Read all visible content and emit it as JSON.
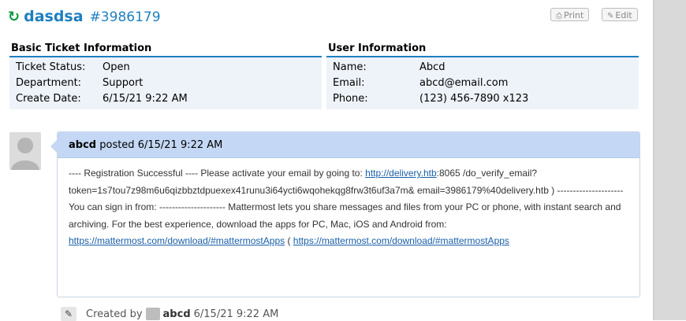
{
  "header": {
    "subject": "dasdsa",
    "number": "#3986179",
    "print_label": "Print",
    "edit_label": "Edit"
  },
  "ticket_info": {
    "title": "Basic Ticket Information",
    "rows": [
      {
        "label": "Ticket Status:",
        "value": "Open"
      },
      {
        "label": "Department:",
        "value": "Support"
      },
      {
        "label": "Create Date:",
        "value": "6/15/21 9:22 AM"
      }
    ]
  },
  "user_info": {
    "title": "User Information",
    "rows": [
      {
        "label": "Name:",
        "value": "Abcd"
      },
      {
        "label": "Email:",
        "value": "abcd@email.com"
      },
      {
        "label": "Phone:",
        "value": "(123) 456-7890 x123"
      }
    ]
  },
  "post": {
    "author": "abcd",
    "posted_text": "posted 6/15/21 9:22 AM",
    "body_1": "---- Registration Successful ---- Please activate your email by going to: ",
    "link_1": "http://delivery.htb",
    "body_2": ":8065 /do_verify_email?token=1s7tou7z98m6u6qizbbztdpuexex41runu3i64ycti6wqohekqg8frw3t6uf3a7m& email=3986179%40delivery.htb ) --------------------- You can sign in from: --------------------- Mattermost lets you share messages and files from your PC or phone, with instant search and archiving. For the best experience, download the apps for PC, Mac, iOS and Android from: ",
    "link_2": "https://mattermost.com/download/#mattermostApps",
    "body_3": " ( ",
    "link_3": "https://mattermost.com/download/#mattermostApps",
    "body_4": ""
  },
  "footer": {
    "created_by": "Created by",
    "author": "abcd",
    "time": "6/15/21 9:22 AM"
  },
  "colors": {
    "accent": "#1d7fc1",
    "refresh_icon": "#0a9a3d",
    "post_header": "#c4d8f5"
  }
}
